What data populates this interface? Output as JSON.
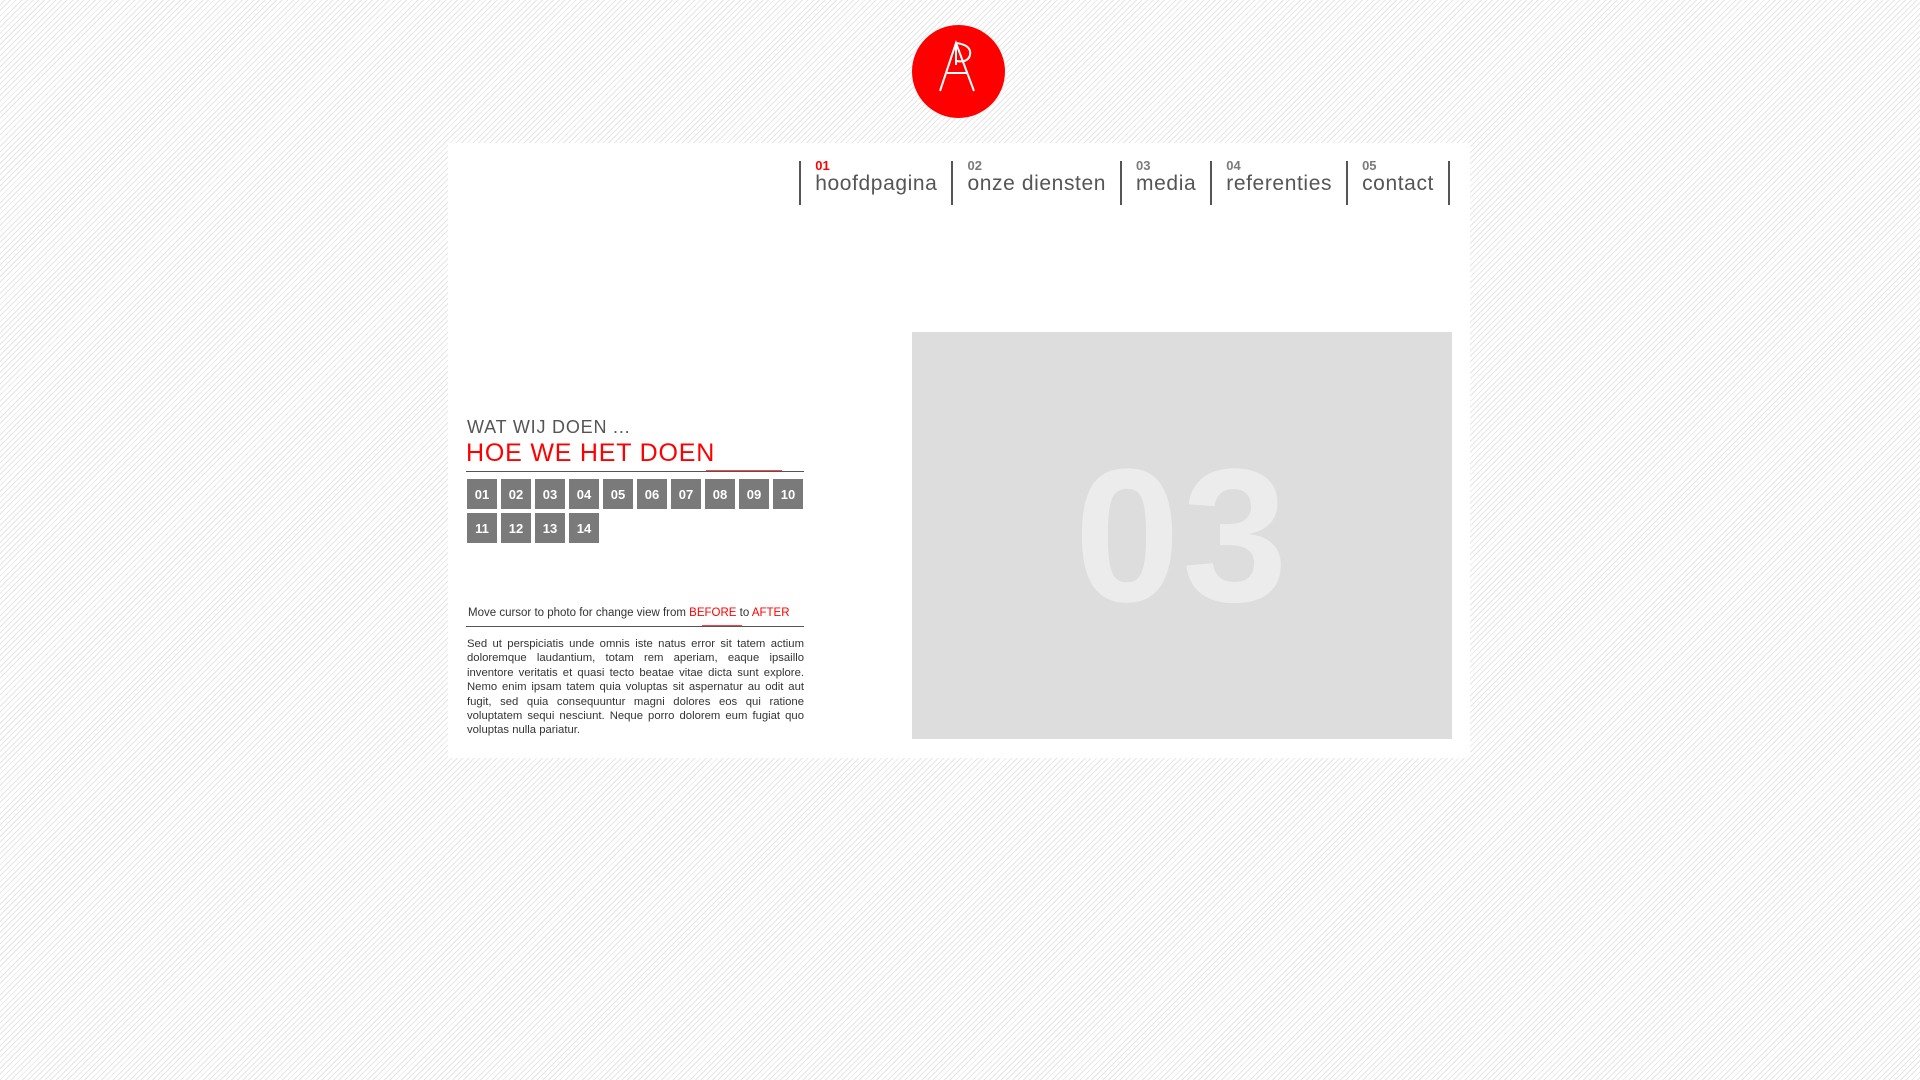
{
  "brand": {
    "logo_icon": "ap-monogram-logo",
    "accent_color": "#ff0000"
  },
  "nav": {
    "items": [
      {
        "num": "01",
        "label": "hoofdpagina",
        "active": true
      },
      {
        "num": "02",
        "label": "onze diensten"
      },
      {
        "num": "03",
        "label": "media"
      },
      {
        "num": "04",
        "label": "referenties"
      },
      {
        "num": "05",
        "label": "contact"
      }
    ]
  },
  "content": {
    "heading_small": "WAT WIJ DOEN ...",
    "heading_big": "HOE WE HET DOEN",
    "pager_row1": [
      "01",
      "02",
      "03",
      "04",
      "05",
      "06",
      "07",
      "08",
      "09",
      "10"
    ],
    "pager_row2": [
      "11",
      "12",
      "13",
      "14"
    ],
    "hint": {
      "prefix": "Move cursor to photo for change view from ",
      "before": "BEFORE",
      "middle": " to ",
      "after": "AFTER"
    },
    "body": "Sed ut perspiciatis unde omnis iste natus error sit tatem actium doloremque laudantium, totam rem aperiam, eaque ipsaillo inventore veritatis et quasi tecto beatae vitae dicta sunt explore. Nemo enim ipsam tatem quia voluptas sit aspernatur au odit aut fugit, sed quia consequuntur magni dolores eos qui ratione voluptatem sequi nesciunt. Neque porro dolorem eum fugiat quo voluptas nulla pariatur."
  },
  "photo": {
    "number": "03"
  }
}
